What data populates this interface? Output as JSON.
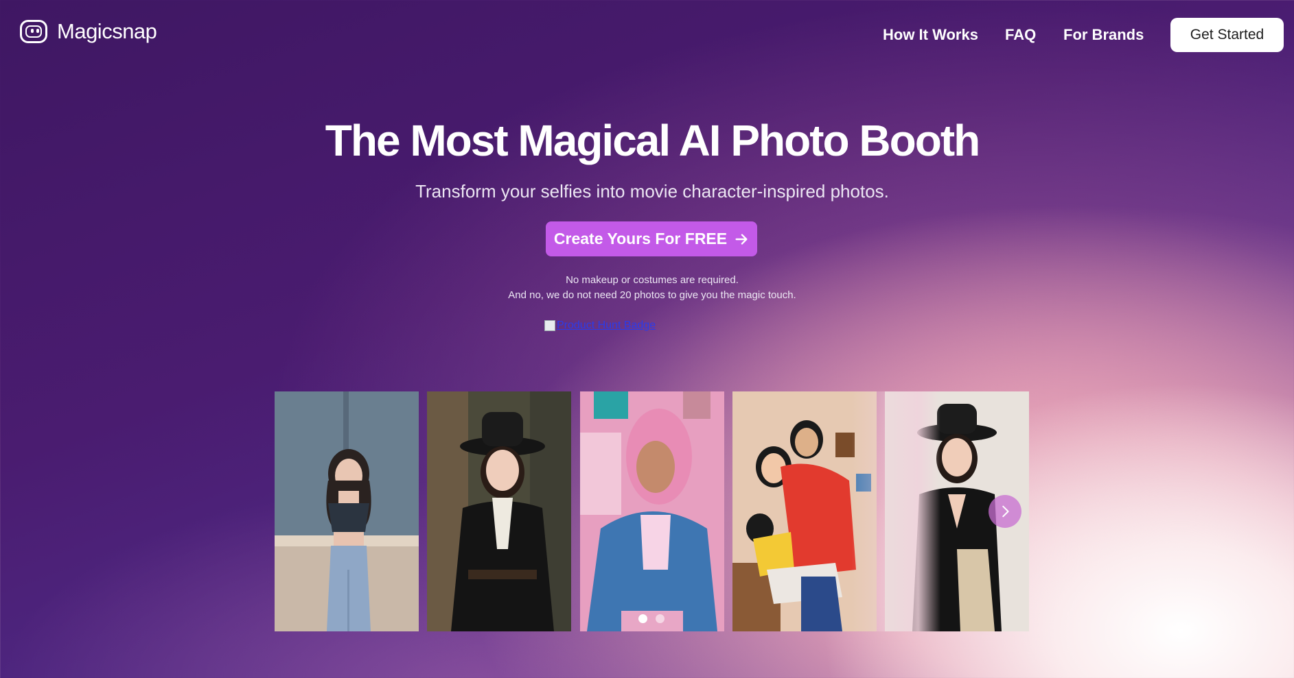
{
  "nav": {
    "brand": "Magicsnap",
    "links": [
      "How It Works",
      "FAQ",
      "For Brands"
    ],
    "cta": "Get Started"
  },
  "hero": {
    "title": "The Most Magical AI Photo Booth",
    "subtitle": "Transform your selfies into movie character-inspired photos.",
    "cta": "Create Yours For FREE",
    "note_line1": "No makeup or costumes are required.",
    "note_line2": "And no, we do not need 20 photos to give you the magic touch.",
    "badge_alt": "Product Hunt Badge"
  },
  "carousel": {
    "photos": [
      "woman with dark wavy hair in tank top against blue wall",
      "woman in black hat and black dress with white collar",
      "man with long pink hair in denim jacket",
      "illustrated couple holding a child in a cozy room",
      "woman in black hat and black-and-cream dress"
    ],
    "dots": 2,
    "active_dot": 0
  },
  "colors": {
    "cta_purple": "#c35ae8",
    "bg_deep_purple": "#4a1c70",
    "bg_pink": "#e4a3b8"
  }
}
